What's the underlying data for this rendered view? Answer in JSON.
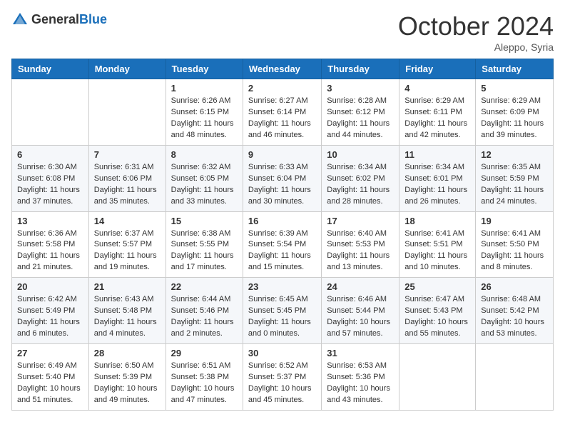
{
  "header": {
    "logo_general": "General",
    "logo_blue": "Blue",
    "month_title": "October 2024",
    "location": "Aleppo, Syria"
  },
  "days_of_week": [
    "Sunday",
    "Monday",
    "Tuesday",
    "Wednesday",
    "Thursday",
    "Friday",
    "Saturday"
  ],
  "weeks": [
    [
      {
        "day": "",
        "info": ""
      },
      {
        "day": "",
        "info": ""
      },
      {
        "day": "1",
        "info": "Sunrise: 6:26 AM\nSunset: 6:15 PM\nDaylight: 11 hours and 48 minutes."
      },
      {
        "day": "2",
        "info": "Sunrise: 6:27 AM\nSunset: 6:14 PM\nDaylight: 11 hours and 46 minutes."
      },
      {
        "day": "3",
        "info": "Sunrise: 6:28 AM\nSunset: 6:12 PM\nDaylight: 11 hours and 44 minutes."
      },
      {
        "day": "4",
        "info": "Sunrise: 6:29 AM\nSunset: 6:11 PM\nDaylight: 11 hours and 42 minutes."
      },
      {
        "day": "5",
        "info": "Sunrise: 6:29 AM\nSunset: 6:09 PM\nDaylight: 11 hours and 39 minutes."
      }
    ],
    [
      {
        "day": "6",
        "info": "Sunrise: 6:30 AM\nSunset: 6:08 PM\nDaylight: 11 hours and 37 minutes."
      },
      {
        "day": "7",
        "info": "Sunrise: 6:31 AM\nSunset: 6:06 PM\nDaylight: 11 hours and 35 minutes."
      },
      {
        "day": "8",
        "info": "Sunrise: 6:32 AM\nSunset: 6:05 PM\nDaylight: 11 hours and 33 minutes."
      },
      {
        "day": "9",
        "info": "Sunrise: 6:33 AM\nSunset: 6:04 PM\nDaylight: 11 hours and 30 minutes."
      },
      {
        "day": "10",
        "info": "Sunrise: 6:34 AM\nSunset: 6:02 PM\nDaylight: 11 hours and 28 minutes."
      },
      {
        "day": "11",
        "info": "Sunrise: 6:34 AM\nSunset: 6:01 PM\nDaylight: 11 hours and 26 minutes."
      },
      {
        "day": "12",
        "info": "Sunrise: 6:35 AM\nSunset: 5:59 PM\nDaylight: 11 hours and 24 minutes."
      }
    ],
    [
      {
        "day": "13",
        "info": "Sunrise: 6:36 AM\nSunset: 5:58 PM\nDaylight: 11 hours and 21 minutes."
      },
      {
        "day": "14",
        "info": "Sunrise: 6:37 AM\nSunset: 5:57 PM\nDaylight: 11 hours and 19 minutes."
      },
      {
        "day": "15",
        "info": "Sunrise: 6:38 AM\nSunset: 5:55 PM\nDaylight: 11 hours and 17 minutes."
      },
      {
        "day": "16",
        "info": "Sunrise: 6:39 AM\nSunset: 5:54 PM\nDaylight: 11 hours and 15 minutes."
      },
      {
        "day": "17",
        "info": "Sunrise: 6:40 AM\nSunset: 5:53 PM\nDaylight: 11 hours and 13 minutes."
      },
      {
        "day": "18",
        "info": "Sunrise: 6:41 AM\nSunset: 5:51 PM\nDaylight: 11 hours and 10 minutes."
      },
      {
        "day": "19",
        "info": "Sunrise: 6:41 AM\nSunset: 5:50 PM\nDaylight: 11 hours and 8 minutes."
      }
    ],
    [
      {
        "day": "20",
        "info": "Sunrise: 6:42 AM\nSunset: 5:49 PM\nDaylight: 11 hours and 6 minutes."
      },
      {
        "day": "21",
        "info": "Sunrise: 6:43 AM\nSunset: 5:48 PM\nDaylight: 11 hours and 4 minutes."
      },
      {
        "day": "22",
        "info": "Sunrise: 6:44 AM\nSunset: 5:46 PM\nDaylight: 11 hours and 2 minutes."
      },
      {
        "day": "23",
        "info": "Sunrise: 6:45 AM\nSunset: 5:45 PM\nDaylight: 11 hours and 0 minutes."
      },
      {
        "day": "24",
        "info": "Sunrise: 6:46 AM\nSunset: 5:44 PM\nDaylight: 10 hours and 57 minutes."
      },
      {
        "day": "25",
        "info": "Sunrise: 6:47 AM\nSunset: 5:43 PM\nDaylight: 10 hours and 55 minutes."
      },
      {
        "day": "26",
        "info": "Sunrise: 6:48 AM\nSunset: 5:42 PM\nDaylight: 10 hours and 53 minutes."
      }
    ],
    [
      {
        "day": "27",
        "info": "Sunrise: 6:49 AM\nSunset: 5:40 PM\nDaylight: 10 hours and 51 minutes."
      },
      {
        "day": "28",
        "info": "Sunrise: 6:50 AM\nSunset: 5:39 PM\nDaylight: 10 hours and 49 minutes."
      },
      {
        "day": "29",
        "info": "Sunrise: 6:51 AM\nSunset: 5:38 PM\nDaylight: 10 hours and 47 minutes."
      },
      {
        "day": "30",
        "info": "Sunrise: 6:52 AM\nSunset: 5:37 PM\nDaylight: 10 hours and 45 minutes."
      },
      {
        "day": "31",
        "info": "Sunrise: 6:53 AM\nSunset: 5:36 PM\nDaylight: 10 hours and 43 minutes."
      },
      {
        "day": "",
        "info": ""
      },
      {
        "day": "",
        "info": ""
      }
    ]
  ]
}
